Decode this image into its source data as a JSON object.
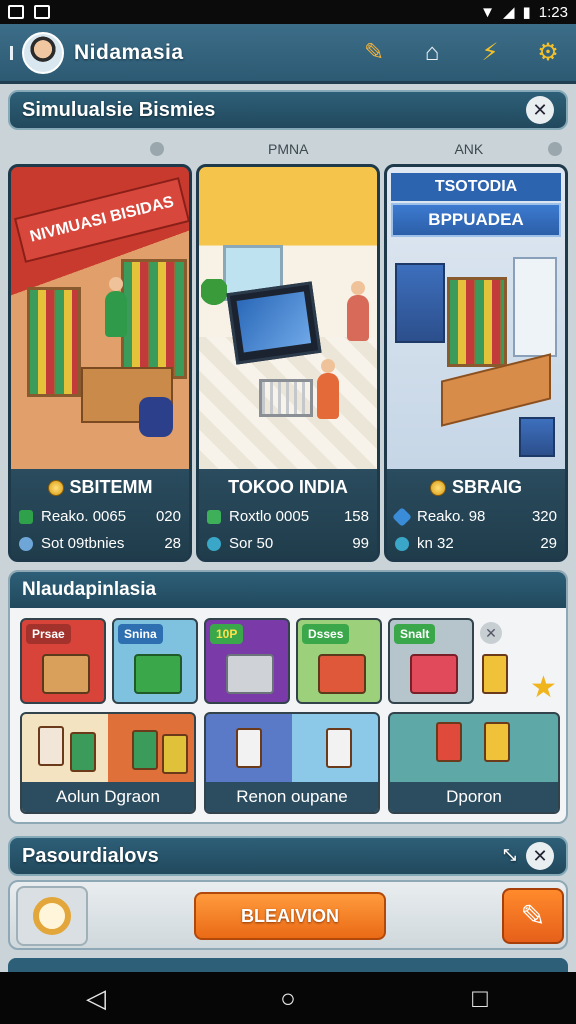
{
  "status_bar": {
    "time": "1:23"
  },
  "app_bar": {
    "title": "Nidamasia"
  },
  "simulation": {
    "title": "Simulualsie Bismies"
  },
  "tabs": {
    "left": "PMNA",
    "right": "ANK"
  },
  "businesses": [
    {
      "name": "SBITEMM",
      "stat1_label": "Reako. 0065",
      "stat1_value": "020",
      "stat2_label": "Sot 09tbnies",
      "stat2_value": "28",
      "banner": "NIVMUASI BISIDAS"
    },
    {
      "name": "TOKOO INDIA",
      "stat1_label": "Roxtlo 0005",
      "stat1_value": "158",
      "stat2_label": "Sor 50",
      "stat2_value": "99"
    },
    {
      "name": "SBRAIG",
      "stat1_label": "Reako. 98",
      "stat1_value": "320",
      "stat2_label": "kn 32",
      "stat2_value": "29",
      "header": "TSOTODIA",
      "subheader": "BPPUADEA"
    }
  ],
  "categories": {
    "title": "Nlaudapinlasia",
    "tiles": [
      {
        "label": "Prsae"
      },
      {
        "label": "Snina"
      },
      {
        "label": "10P"
      },
      {
        "label": "Dsses"
      },
      {
        "label": "Snalt"
      }
    ],
    "groups": [
      {
        "label": "Aolun Dgraon"
      },
      {
        "label": "Renon oupane"
      },
      {
        "label": "Dporon"
      }
    ]
  },
  "bottom": {
    "title": "Pasourdialovs",
    "primary_button": "BLEAIVION"
  },
  "colors": {
    "accent": "#ea6a16",
    "header": "#2d5f78"
  }
}
